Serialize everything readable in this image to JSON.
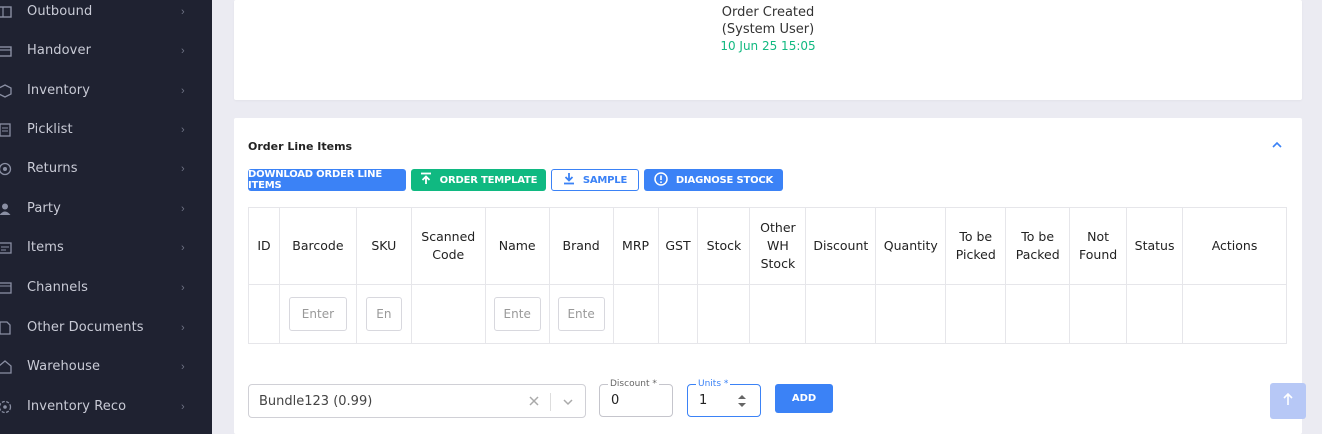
{
  "sidebar": {
    "items": [
      {
        "label": "Outbound",
        "icon": "outbound-icon"
      },
      {
        "label": "Handover",
        "icon": "handover-icon"
      },
      {
        "label": "Inventory",
        "icon": "inventory-icon"
      },
      {
        "label": "Picklist",
        "icon": "picklist-icon"
      },
      {
        "label": "Returns",
        "icon": "returns-icon"
      },
      {
        "label": "Party",
        "icon": "party-icon"
      },
      {
        "label": "Items",
        "icon": "items-icon"
      },
      {
        "label": "Channels",
        "icon": "channels-icon"
      },
      {
        "label": "Other Documents",
        "icon": "documents-icon"
      },
      {
        "label": "Warehouse",
        "icon": "warehouse-icon"
      },
      {
        "label": "Inventory Reco",
        "icon": "inventory-reco-icon"
      }
    ],
    "chevron": "›"
  },
  "timeline": {
    "title": "Order Created",
    "actor": "(System User)",
    "timestamp": "10 Jun 25 15:05"
  },
  "line_items": {
    "title": "Order Line Items",
    "buttons": {
      "download": "DOWNLOAD ORDER LINE ITEMS",
      "template": "ORDER TEMPLATE",
      "sample": "SAMPLE",
      "diagnose": "DIAGNOSE STOCK"
    },
    "columns": [
      "ID",
      "Barcode",
      "SKU",
      "Scanned Code",
      "Name",
      "Brand",
      "MRP",
      "GST",
      "Stock",
      "Other WH Stock",
      "Discount",
      "Quantity",
      "To be Picked",
      "To be Packed",
      "Not Found",
      "Status",
      "Actions"
    ],
    "filters": {
      "barcode_placeholder": "Enter",
      "sku_placeholder": "En",
      "name_placeholder": "Ente",
      "brand_placeholder": "Ente"
    }
  },
  "add_form": {
    "bundle_value": "Bundle123 (0.99)",
    "discount_label": "Discount *",
    "discount_value": "0",
    "units_label": "Units *",
    "units_value": "1",
    "add_label": "ADD"
  },
  "colors": {
    "sidebar_bg": "#1f2231",
    "accent": "#3b82f6",
    "success": "#10b981"
  }
}
